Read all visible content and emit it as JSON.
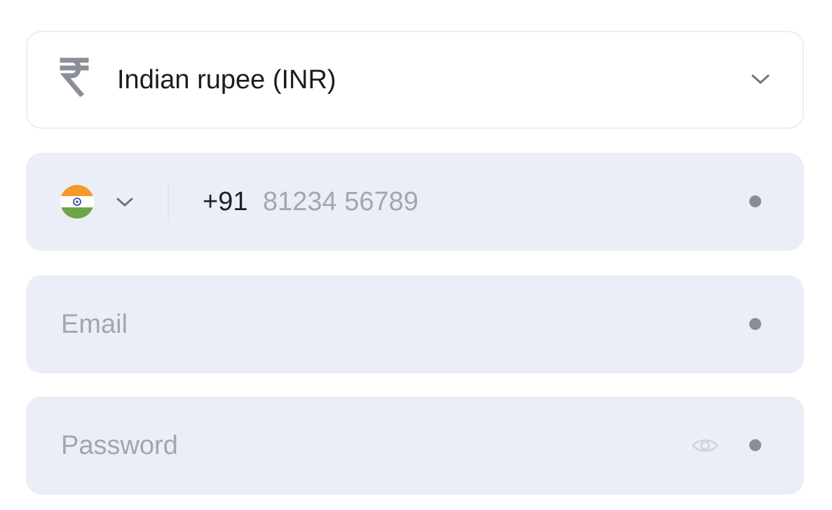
{
  "currency": {
    "selected_label": "Indian rupee (INR)",
    "icon": "rupee-icon",
    "chevron": "chevron-down-icon"
  },
  "phone": {
    "country_flag": "india-flag-icon",
    "dial_code": "+91",
    "placeholder": "81234 56789",
    "value": ""
  },
  "email": {
    "placeholder": "Email",
    "value": ""
  },
  "password": {
    "placeholder": "Password",
    "value": "",
    "toggle_icon": "eye-icon"
  },
  "colors": {
    "field_background": "#ebeef6",
    "placeholder": "#a1a6b1",
    "required_dot": "#8c8d91",
    "icon_gray": "#8a8f98"
  }
}
